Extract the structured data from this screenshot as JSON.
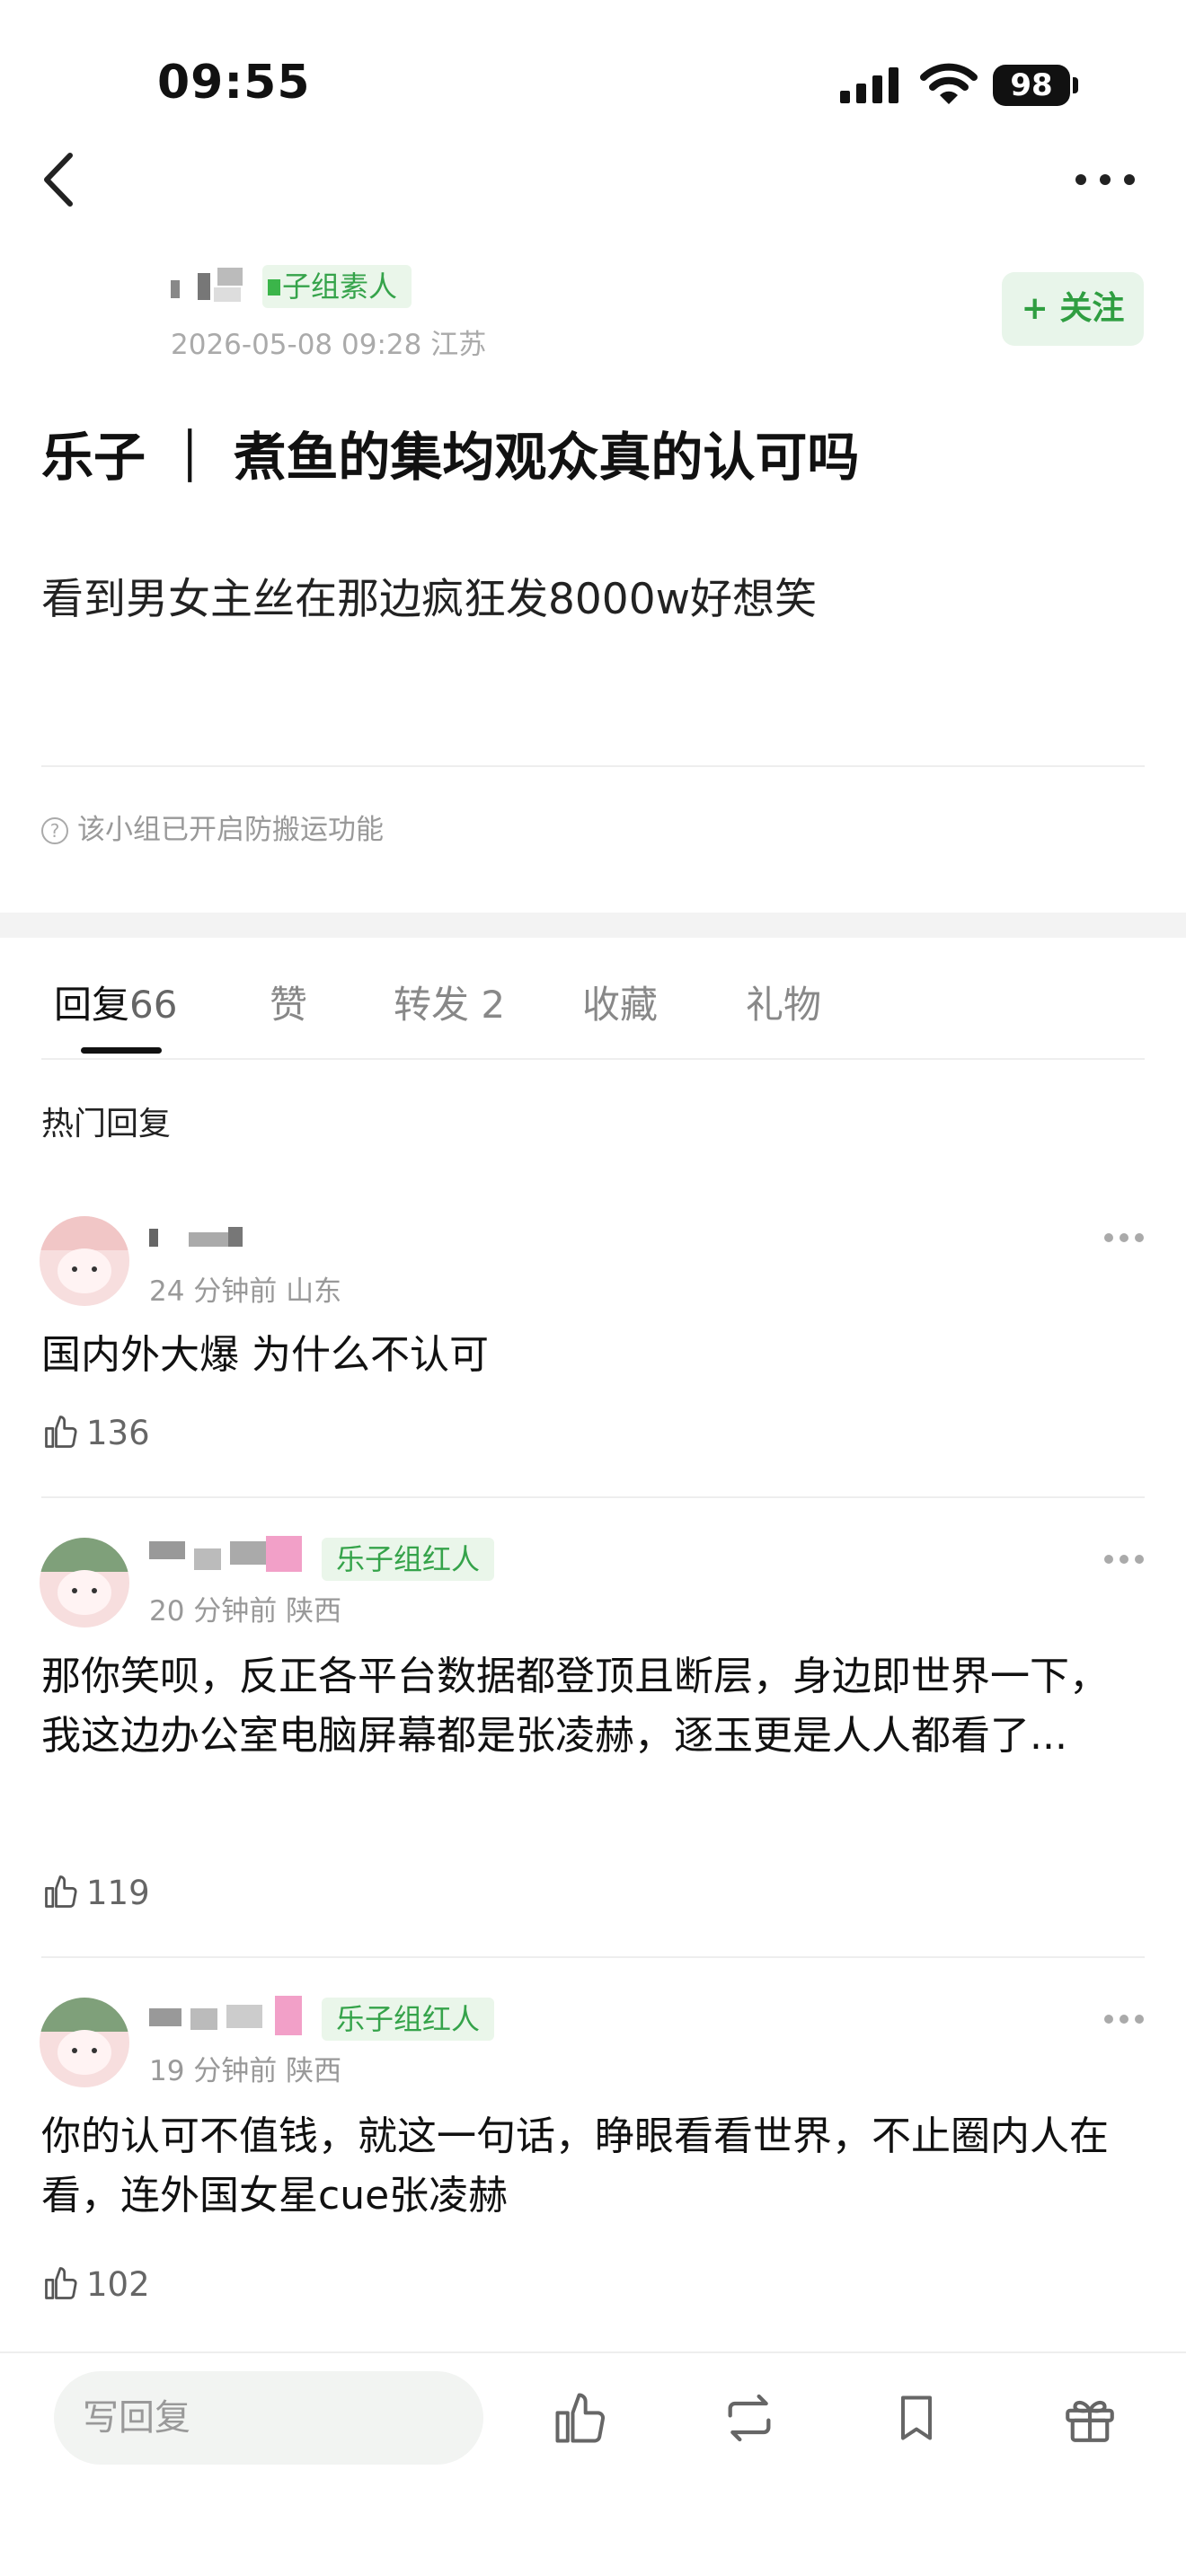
{
  "status_bar": {
    "time": "09:55",
    "battery": "98"
  },
  "post": {
    "group_badge": "子组素人",
    "meta": "2026-05-08 09:28  江苏",
    "follow_label": "+ 关注",
    "title": "乐子 ｜ 煮鱼的集均观众真的认可吗",
    "body": "看到男女主丝在那边疯狂发8000w好想笑",
    "notice": "该小组已开启防搬运功能"
  },
  "tabs": {
    "replies_label": "回复",
    "replies_count": "66",
    "likes_label": "赞",
    "reposts_label": "转发",
    "reposts_count": "2",
    "favorites_label": "收藏",
    "gifts_label": "礼物"
  },
  "hot_replies_label": "热门回复",
  "comments": [
    {
      "meta": "24 分钟前  山东",
      "text": "国内外大爆 为什么不认可",
      "likes": "136"
    },
    {
      "badge": "乐子组红人",
      "meta": "20 分钟前  陕西",
      "text": "那你笑呗，反正各平台数据都登顶且断层，身边即世界一下，我这边办公室电脑屏幕都是张凌赫，逐玉更是人人都看了...",
      "likes": "119"
    },
    {
      "badge": "乐子组红人",
      "meta": "19 分钟前  陕西",
      "text": "你的认可不值钱，就这一句话，睁眼看看世界，不止圈内人在看，连外国女星cue张凌赫",
      "likes": "102"
    }
  ],
  "bottom_bar": {
    "reply_placeholder": "写回复"
  },
  "colors": {
    "accent_green": "#35a34a",
    "follow_bg": "#e8f5ea"
  }
}
